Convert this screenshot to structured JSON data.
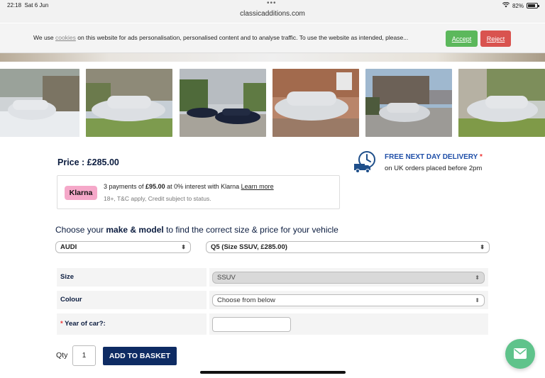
{
  "status_bar": {
    "time": "22:18",
    "date": "Sat 6 Jun",
    "dots": "•••",
    "battery": "82%"
  },
  "url": "classicadditions.com",
  "cookie": {
    "text_before": "We use ",
    "link": "cookies",
    "text_after": " on this website for ads personalisation, personalised content and to analyse traffic. To use the website as intended, please...",
    "accept": "Accept",
    "reject": "Reject"
  },
  "product": {
    "price": "Price : £285.00",
    "klarna": {
      "logo": "Klarna",
      "line1_a": "3 payments of ",
      "line1_amount": "£95.00",
      "line1_b": " at 0% interest with Klarna ",
      "learn_more": "Learn more",
      "line2": "18+, T&C apply, Credit subject to status."
    },
    "delivery": {
      "title": "FREE NEXT DAY DELIVERY",
      "star": "*",
      "text": "on UK orders placed before 2pm"
    }
  },
  "chooser": {
    "text_a": "Choose your ",
    "text_bold": "make & model",
    "text_b": " to find the correct size & price for your vehicle",
    "make": "AUDI",
    "model": "Q5 (Size SSUV, £285.00)"
  },
  "options": {
    "size_label": "Size",
    "size_value": "SSUV",
    "colour_label": "Colour",
    "colour_value": "Choose from below",
    "year_required": "*",
    "year_label": "Year of car?:"
  },
  "basket": {
    "qty_label": "Qty",
    "qty": "1",
    "button": "ADD TO BASKET"
  },
  "icons": {
    "wifi": "wifi-icon",
    "battery": "battery-icon",
    "delivery": "delivery-truck-clock-icon",
    "chat": "mail-icon",
    "select_arrow": "chevron-updown-icon"
  },
  "colors": {
    "accent": "#0e2b63",
    "accept": "#5cb85c",
    "reject": "#d9534f",
    "delivery": "#1f4fa8",
    "klarna": "#f5a8c9",
    "chat": "#5fc38b"
  }
}
